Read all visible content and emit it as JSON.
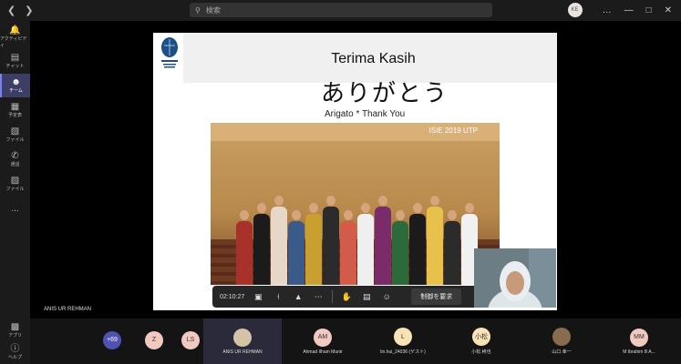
{
  "titlebar": {
    "back_icon": "chevron-left",
    "forward_icon": "chevron-right",
    "search_placeholder": "検索",
    "user_initials": "KE",
    "controls": [
      "minimize",
      "maximize",
      "close"
    ]
  },
  "rail": {
    "items": [
      {
        "label": "アクティビティ",
        "icon": "bell"
      },
      {
        "label": "チャット",
        "icon": "chat"
      },
      {
        "label": "チーム",
        "icon": "team"
      },
      {
        "label": "予定表",
        "icon": "calendar"
      },
      {
        "label": "ファイル",
        "icon": "file"
      },
      {
        "label": "通話",
        "icon": "phone"
      },
      {
        "label": "ファイル",
        "icon": "file"
      },
      {
        "label": "...",
        "icon": "more"
      }
    ],
    "bottom_items": [
      {
        "label": "アプリ",
        "icon": "apps"
      },
      {
        "label": "ヘルプ",
        "icon": "help"
      }
    ]
  },
  "slide": {
    "title": "Terima Kasih",
    "japanese": "ありがとう",
    "subtitle": "Arigato * Thank You",
    "photo_caption": "ISIE 2019 UTP"
  },
  "call": {
    "timer": "02:10:27",
    "request_control": "制御を要求",
    "speaker": "ANIS UR REHMAN"
  },
  "gallery": {
    "tiles": [
      {
        "initials": "+69",
        "name": "",
        "color": "#4f52b2"
      },
      {
        "initials": "Z",
        "name": "",
        "color": "#f1c9c1"
      },
      {
        "initials": "LS",
        "name": "",
        "color": "#f1c9c1"
      },
      {
        "initials": "",
        "name": "ANIS UR REHMAN",
        "color": "#d5c3a8"
      },
      {
        "initials": "AM",
        "name": "Ahmad Ilham Munir",
        "color": "#f1c9c1"
      },
      {
        "initials": "L",
        "name": "lin.hui_24036 (ゲスト)",
        "color": "#f7e3b5"
      },
      {
        "initials": "小松",
        "name": "小松 柊也",
        "color": "#f7e3b5"
      },
      {
        "initials": "",
        "name": "山口 幸一",
        "color": "#8a6b4f"
      },
      {
        "initials": "MM",
        "name": "M Ibrahim B A...",
        "color": "#f1c9c1"
      }
    ]
  },
  "colors": {
    "accent": "#7b83eb",
    "hangup": "#c4314b",
    "stage": "#000000"
  }
}
